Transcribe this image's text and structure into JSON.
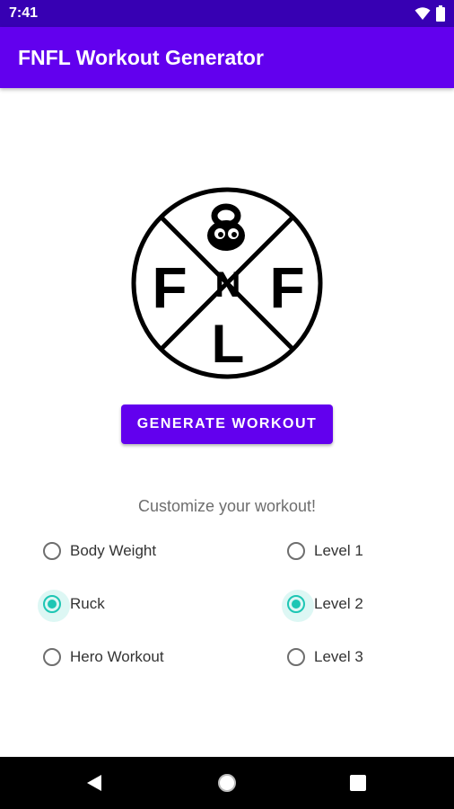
{
  "status_bar": {
    "time": "7:41",
    "icons": [
      "wifi-icon",
      "battery-icon"
    ]
  },
  "app_bar": {
    "title": "FNFL Workout Generator",
    "color": "#6200ee"
  },
  "logo": {
    "letters": {
      "left": "F",
      "center": "N",
      "right": "F",
      "bottom": "L"
    }
  },
  "generate_button": {
    "label": "GENERATE WORKOUT"
  },
  "customize": {
    "label": "Customize your workout!"
  },
  "workout_types": [
    {
      "label": "Body Weight",
      "checked": false
    },
    {
      "label": "Ruck",
      "checked": true
    },
    {
      "label": "Hero Workout",
      "checked": false
    }
  ],
  "levels": [
    {
      "label": "Level 1",
      "checked": false
    },
    {
      "label": "Level 2",
      "checked": true
    },
    {
      "label": "Level 3",
      "checked": false
    }
  ],
  "nav_bar": {
    "icons": [
      "back-icon",
      "home-icon",
      "recents-icon"
    ]
  },
  "colors": {
    "primary": "#6200ee",
    "primary_dark": "#3700b3",
    "accent": "#1ec6b4"
  }
}
